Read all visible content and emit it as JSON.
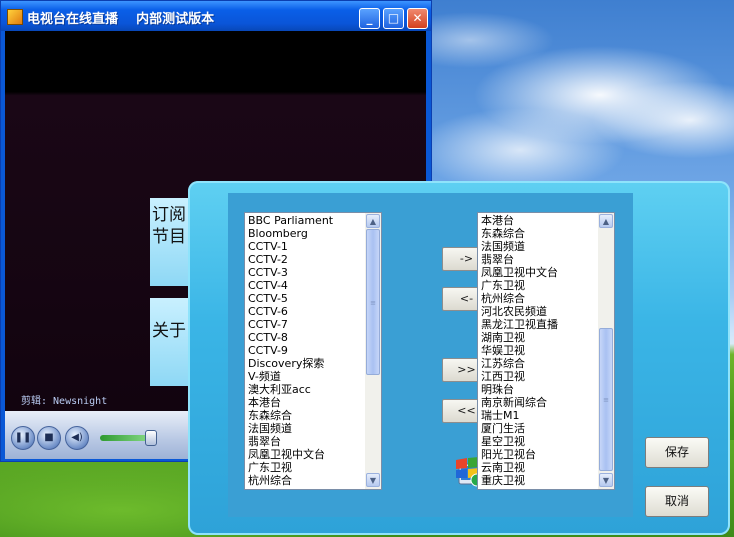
{
  "player": {
    "title": "电视台在线直播    内部测试版本",
    "credit": "剪辑: Newsnight",
    "minimize_glyph": "_",
    "maximize_glyph": "□",
    "close_glyph": "✕",
    "controls": {
      "pause_glyph": "❚❚",
      "stop_glyph": "■",
      "mute_glyph": "◀)",
      "volume_level": 0.9
    }
  },
  "side_tabs": {
    "subscribe_label": "订阅节目",
    "about_label": "关于"
  },
  "dialog": {
    "left_list": {
      "items": [
        "BBC Parliament",
        "Bloomberg",
        "CCTV-1",
        "CCTV-2",
        "CCTV-3",
        "CCTV-4",
        "CCTV-5",
        "CCTV-6",
        "CCTV-7",
        "CCTV-8",
        "CCTV-9",
        "Discovery探索",
        "V-频道",
        "澳大利亚acc",
        "本港台",
        "东森综合",
        "法国频道",
        "翡翠台",
        "凤凰卫视中文台",
        "广东卫视",
        "杭州综合"
      ]
    },
    "right_list": {
      "items": [
        "本港台",
        "东森综合",
        "法国频道",
        "翡翠台",
        "凤凰卫视中文台",
        "广东卫视",
        "杭州综合",
        "河北农民频道",
        "黑龙江卫视直播",
        "湖南卫视",
        "华娱卫视",
        "江苏综合",
        "江西卫视",
        "明珠台",
        "南京新闻综合",
        "瑞士M1",
        "厦门生活",
        "星空卫视",
        "阳光卫视台",
        "云南卫视",
        "重庆卫视"
      ]
    },
    "buttons": {
      "add_one": "->",
      "remove_one": "<-",
      "add_all": ">>",
      "remove_all": "<<",
      "save": "保存",
      "cancel": "取消"
    },
    "icons": {
      "app": "windows-update-icon",
      "scroll_up": "▲",
      "scroll_down": "▼",
      "thumb_grip": "≡"
    }
  }
}
